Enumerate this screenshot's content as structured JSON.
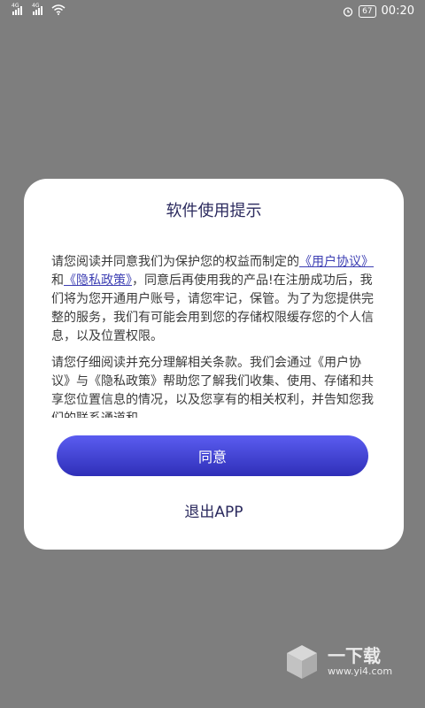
{
  "status_bar": {
    "signal1_tag": "4G",
    "signal2_tag": "4G",
    "battery": "67",
    "time": "00:20"
  },
  "dialog": {
    "title": "软件使用提示",
    "p1_before": "请您阅读并同意我们为保护您的权益而制定的",
    "link_user_agreement": "《用户协议》",
    "p1_and": "和",
    "link_privacy_policy": "《隐私政策》",
    "p1_after": "，同意后再使用我的产品!在注册成功后，我们将为您开通用户账号，请您牢记，保管。为了为您提供完整的服务，我们有可能会用到您的存储权限缓存您的个人信息，以及位置权限。",
    "p2": "请您仔细阅读并充分理解相关条款。我们会通过《用户协议》与《隐私政策》帮助您了解我们收集、使用、存储和共享您位置信息的情况，以及您享有的相关权利，并告知您我们的联系通道和",
    "agree_label": "同意",
    "exit_label": "退出APP"
  },
  "watermark": {
    "title": "一下载",
    "url": "www.yi4.com"
  }
}
